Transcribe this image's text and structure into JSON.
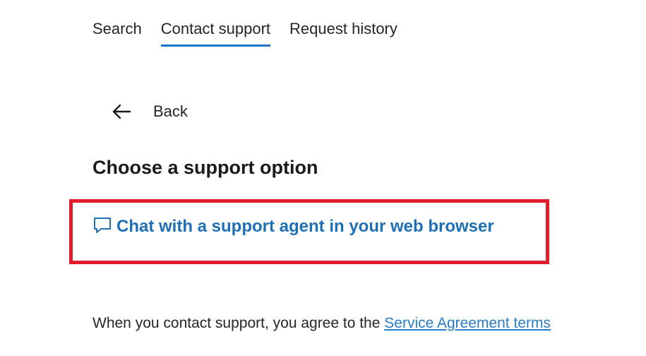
{
  "tabs": [
    {
      "label": "Search",
      "active": false
    },
    {
      "label": "Contact support",
      "active": true
    },
    {
      "label": "Request history",
      "active": false
    }
  ],
  "back": {
    "icon": "arrow-left-icon",
    "label": "Back"
  },
  "heading": "Choose a support option",
  "options": {
    "chat": {
      "icon": "chat-bubble-icon",
      "label": "Chat with a support agent in your web browser"
    }
  },
  "footer": {
    "agreement_text": "When you contact support, you agree to the ",
    "agreement_link": "Service Agreement terms"
  },
  "colors": {
    "accent": "#1a73c7",
    "link": "#1f6fb5",
    "highlight": "#e01d2c"
  }
}
